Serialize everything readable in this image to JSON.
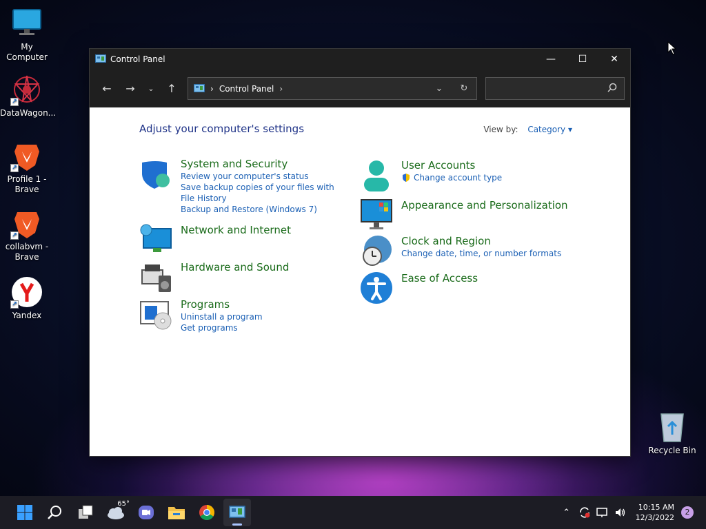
{
  "desktop": {
    "icons": [
      {
        "label": "My Computer"
      },
      {
        "label": "DataWagon..."
      },
      {
        "label": "Profile 1 - Brave"
      },
      {
        "label": "collabvm - Brave"
      },
      {
        "label": "Yandex"
      }
    ],
    "recycle_bin": "Recycle Bin"
  },
  "window": {
    "title": "Control Panel",
    "breadcrumb": "Control Panel",
    "search_placeholder": "",
    "heading": "Adjust your computer's settings",
    "view_by_label": "View by:",
    "view_by_value": "Category",
    "categories_left": [
      {
        "title": "System and Security",
        "links": [
          "Review your computer's status",
          "Save backup copies of your files with File History",
          "Backup and Restore (Windows 7)"
        ]
      },
      {
        "title": "Network and Internet",
        "links": []
      },
      {
        "title": "Hardware and Sound",
        "links": []
      },
      {
        "title": "Programs",
        "links": [
          "Uninstall a program",
          "Get programs"
        ]
      }
    ],
    "categories_right": [
      {
        "title": "User Accounts",
        "links": [
          "Change account type"
        ]
      },
      {
        "title": "Appearance and Personalization",
        "links": []
      },
      {
        "title": "Clock and Region",
        "links": [
          "Change date, time, or number formats"
        ]
      },
      {
        "title": "Ease of Access",
        "links": []
      }
    ]
  },
  "taskbar": {
    "weather_temp": "65°",
    "time": "10:15 AM",
    "date": "12/3/2022",
    "notification_count": "2"
  },
  "colors": {
    "category_title": "#1a6b1a",
    "link": "#1a5fb4",
    "heading": "#1e3287"
  }
}
